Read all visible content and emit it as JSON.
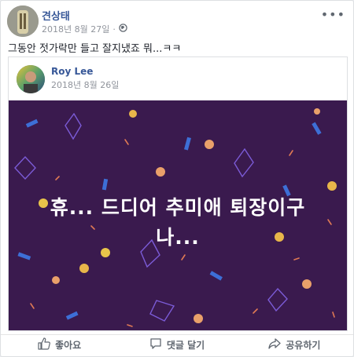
{
  "post": {
    "author": "견상태",
    "date": "2018년 8월 27일",
    "separator": "·",
    "text": "그동안 젓가락만 들고 잘지냈죠 뭐...ㅋㅋ",
    "menu_glyph": "•••"
  },
  "shared": {
    "author": "Roy Lee",
    "date": "2018년 8월 26일",
    "banner_line1": "휴... 드디어 추미애 퇴장이구",
    "banner_line2": "나...",
    "banner_bg": "#3a1a4e"
  },
  "actions": {
    "like": "좋아요",
    "comment": "댓글 달기",
    "share": "공유하기"
  },
  "colors": {
    "link": "#385898",
    "muted": "#90949c"
  }
}
